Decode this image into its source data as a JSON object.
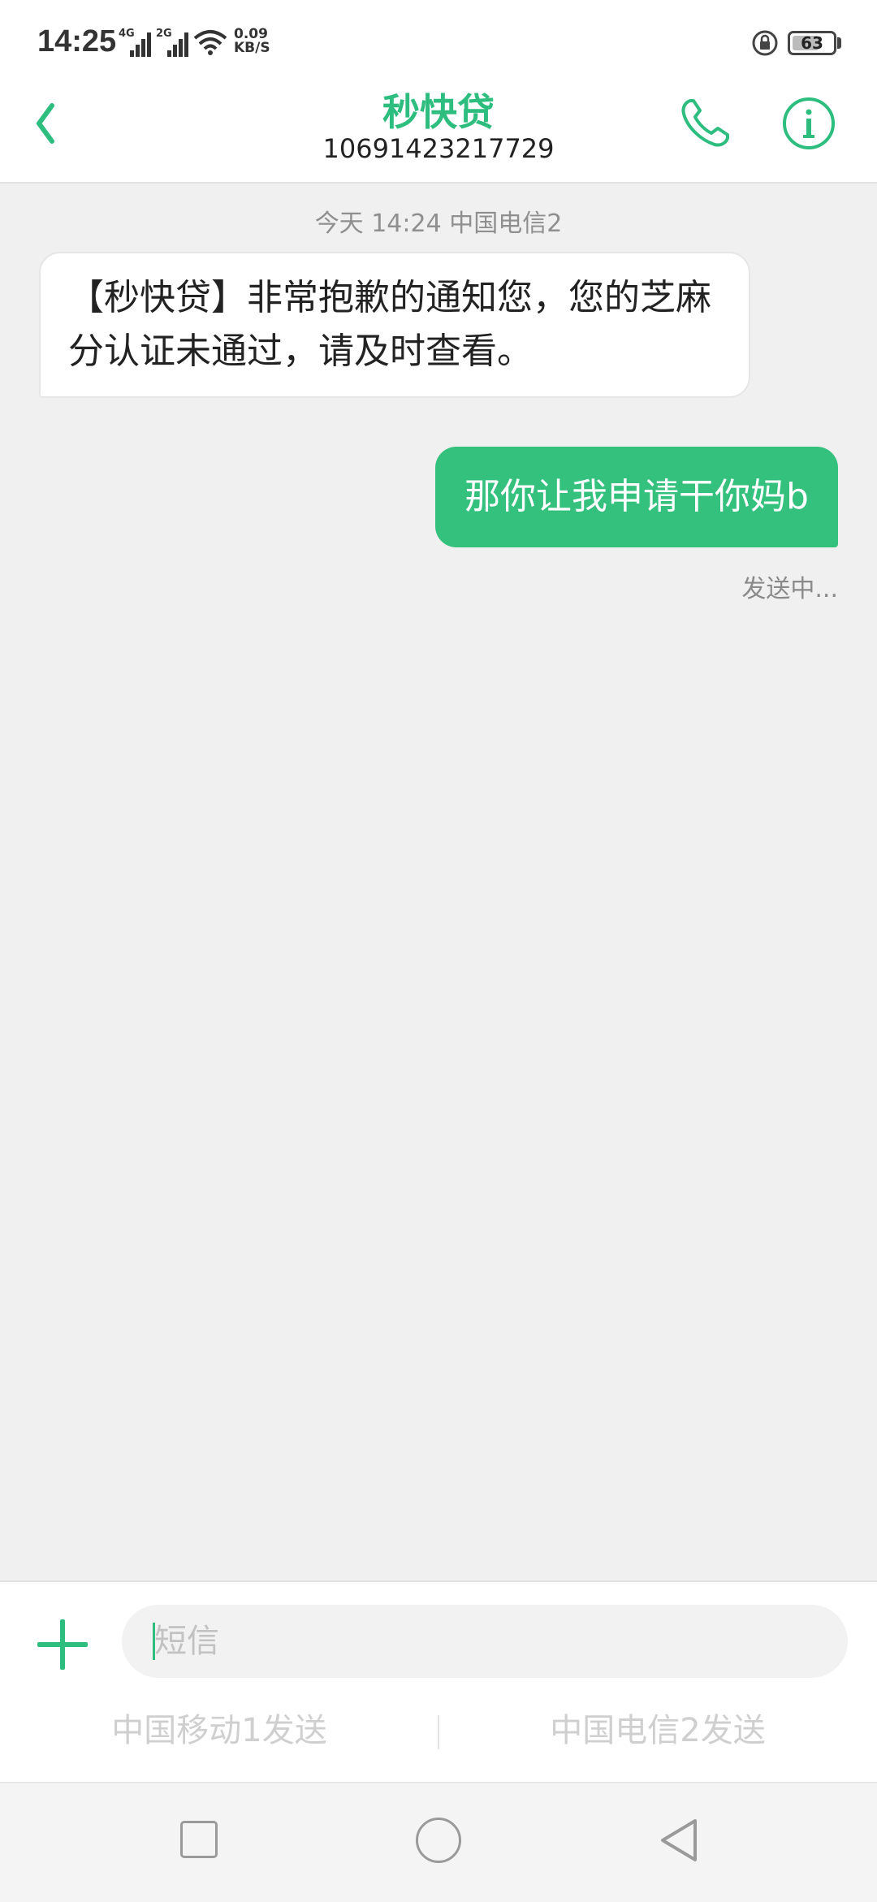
{
  "status_bar": {
    "time": "14:25",
    "signal1_network": "4G",
    "signal2_network": "2G",
    "speed_value": "0.09",
    "speed_unit": "KB/S",
    "battery": "63"
  },
  "header": {
    "contact_name": "秒快贷",
    "contact_number": "10691423217729",
    "icons": [
      "back-icon",
      "phone-icon",
      "info-icon"
    ]
  },
  "conversation": {
    "meta": "今天 14:24  中国电信2",
    "incoming_text": "【秒快贷】非常抱歉的通知您，您的芝麻分认证未通过，请及时查看。",
    "outgoing_text": "那你让我申请干你妈b",
    "outgoing_status": "发送中..."
  },
  "compose": {
    "placeholder": "短信",
    "send_sim1": "中国移动1发送",
    "send_sim2": "中国电信2发送"
  },
  "colors": {
    "accent": "#2dbd7e",
    "outgoing_bubble": "#34c07d",
    "background": "#f0f0f0"
  }
}
